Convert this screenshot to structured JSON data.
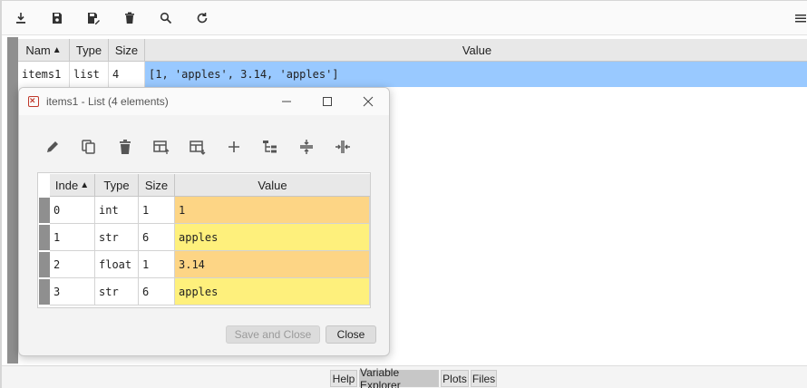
{
  "toolbar": {
    "icons": [
      "import-icon",
      "save-icon",
      "save-as-icon",
      "delete-icon",
      "search-icon",
      "refresh-icon",
      "menu-icon"
    ]
  },
  "main_table": {
    "headers": {
      "name": "Nam",
      "type": "Type",
      "size": "Size",
      "value": "Value"
    },
    "rows": [
      {
        "name": "items1",
        "type": "list",
        "size": "4",
        "value": "[1, 'apples', 3.14, 'apples']"
      }
    ]
  },
  "bottom_tabs": {
    "help": "Help",
    "variable_explorer": "Variable Explorer",
    "plots": "Plots",
    "files": "Files"
  },
  "dialog": {
    "title": "items1 - List (4 elements)",
    "headers": {
      "index": "Inde",
      "type": "Type",
      "size": "Size",
      "value": "Value"
    },
    "rows": [
      {
        "index": "0",
        "type": "int",
        "size": "1",
        "value": "1",
        "color": "#fdd585"
      },
      {
        "index": "1",
        "type": "str",
        "size": "6",
        "value": "apples",
        "color": "#fef07c"
      },
      {
        "index": "2",
        "type": "float",
        "size": "1",
        "value": "3.14",
        "color": "#fdd585"
      },
      {
        "index": "3",
        "type": "str",
        "size": "6",
        "value": "apples",
        "color": "#fef07c"
      }
    ],
    "save_close_label": "Save and Close",
    "close_label": "Close"
  },
  "colors": {
    "selected_row": "#99c9ff",
    "numeric_value": "#fdd585",
    "string_value": "#fef07c",
    "gutter": "#8f8f8f"
  }
}
